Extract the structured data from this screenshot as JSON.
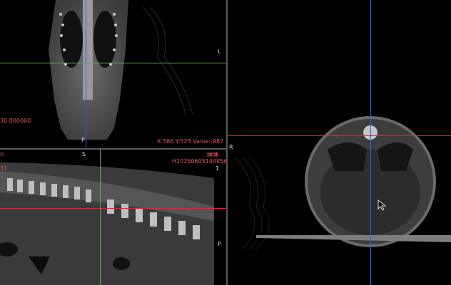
{
  "coronal_view": {
    "orient_right": "L",
    "orient_bottom": "P",
    "slice_value": "30.000000",
    "readout": "X:586 Y:525 Value:-987"
  },
  "sagittal_view": {
    "orient_top": "S",
    "orient_right": "P",
    "patient_name": "睡睡",
    "patient_id": "H20250605144856",
    "series_number": "1",
    "left_edge": "n",
    "left_edge_2": "31"
  },
  "axial_view": {
    "orient_left": "R"
  },
  "colors": {
    "crosshair_red": "#d22c3c",
    "crosshair_blue": "#2e5cff",
    "crosshair_green": "#6aa84f",
    "label_orange": "#e05a5a"
  }
}
